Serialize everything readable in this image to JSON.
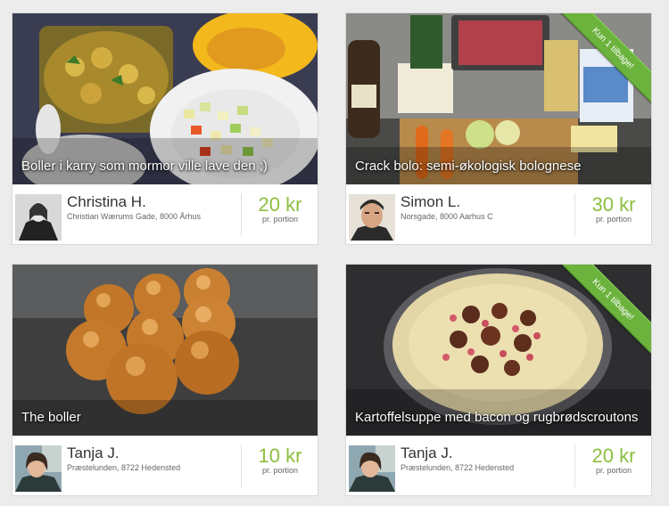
{
  "listings": [
    {
      "title": "Boller i karry som mormor ville lave den ;)",
      "cook": "Christina H.",
      "address": "Christian Wærums Gade, 8000 Århus",
      "price": "20 kr",
      "unit": "pr. portion",
      "badge": ""
    },
    {
      "title": "Crack bolo: semi-økologisk bolognese",
      "cook": "Simon L.",
      "address": "Norsgade, 8000 Aarhus C",
      "price": "30 kr",
      "unit": "pr. portion",
      "badge": "Kun 1 tilbage!"
    },
    {
      "title": "The boller",
      "cook": "Tanja J.",
      "address": "Præstelunden, 8722 Hedensted",
      "price": "10 kr",
      "unit": "pr. portion",
      "badge": ""
    },
    {
      "title": "Kartoffelsuppe med bacon og rugbrødscroutons",
      "cook": "Tanja J.",
      "address": "Præstelunden, 8722 Hedensted",
      "price": "20 kr",
      "unit": "pr. portion",
      "badge": "Kun 1 tilbage!"
    }
  ],
  "colors": {
    "price": "#8cbf3f",
    "badge": "#6cb33e"
  }
}
